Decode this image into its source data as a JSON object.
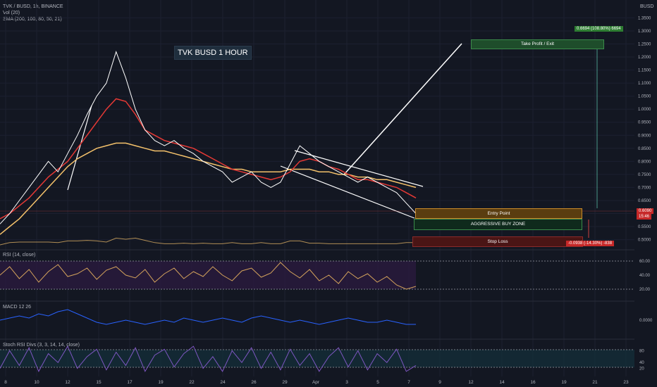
{
  "header": {
    "symbol": "TVK / BUSD, 1h, BINANCE",
    "vol": "Vol (20)",
    "sma": "SMA (200, 100, 80, 50, 21)",
    "currency": "BUSD"
  },
  "annotation_title": "TVK BUSD 1 HOUR",
  "zones": {
    "take_profit": "Take Profit / Exit",
    "entry": "Entry Point",
    "buy_zone": "AGGRESSIVE BUY ZONE",
    "stop_loss": "Stop Loss"
  },
  "labels": {
    "target": "0.6694 (108.80%) 6694",
    "stop": "-0.0938 (-14.30%) -838",
    "price_now": "0.6090",
    "countdown": "15:46"
  },
  "panes": {
    "rsi": "RSI (14, close)",
    "macd": "MACD 12 26",
    "stoch": "Stoch RSI Divs (3, 3, 14, 14, close)"
  },
  "colors": {
    "background": "#131722",
    "price": "#ffffff",
    "sma_fast": "#e53935",
    "sma_slow": "#f5c26b",
    "take_profit": "#1e4d2b",
    "entry": "#5a3d10",
    "stop": "#4a1515"
  },
  "chart_data": {
    "type": "line",
    "x_ticks": [
      "8",
      "10",
      "12",
      "15",
      "17",
      "19",
      "22",
      "24",
      "26",
      "29",
      "Apr",
      "3",
      "5",
      "7",
      "9",
      "12",
      "14",
      "16",
      "19",
      "21",
      "23"
    ],
    "price_axis": [
      "1.3500",
      "1.3000",
      "1.2500",
      "1.2000",
      "1.1500",
      "1.1000",
      "1.0500",
      "1.0000",
      "0.9500",
      "0.9000",
      "0.8500",
      "0.8000",
      "0.7500",
      "0.7000",
      "0.6500",
      "0.6000",
      "0.5500",
      "0.5000"
    ],
    "ylim": [
      0.48,
      1.37
    ],
    "price_series": [
      0.56,
      0.6,
      0.65,
      0.7,
      0.75,
      0.8,
      0.76,
      0.83,
      0.9,
      0.98,
      1.05,
      1.1,
      1.22,
      1.12,
      1.0,
      0.92,
      0.88,
      0.86,
      0.88,
      0.85,
      0.83,
      0.8,
      0.78,
      0.76,
      0.72,
      0.74,
      0.76,
      0.72,
      0.7,
      0.72,
      0.79,
      0.86,
      0.83,
      0.8,
      0.78,
      0.76,
      0.74,
      0.72,
      0.74,
      0.72,
      0.7,
      0.68,
      0.64,
      0.6
    ],
    "sma_fast": [
      0.58,
      0.6,
      0.63,
      0.66,
      0.7,
      0.74,
      0.77,
      0.8,
      0.85,
      0.9,
      0.95,
      1.0,
      1.04,
      1.03,
      0.98,
      0.92,
      0.9,
      0.88,
      0.87,
      0.86,
      0.85,
      0.83,
      0.81,
      0.79,
      0.77,
      0.76,
      0.75,
      0.74,
      0.73,
      0.74,
      0.76,
      0.8,
      0.81,
      0.8,
      0.78,
      0.77,
      0.75,
      0.73,
      0.73,
      0.72,
      0.71,
      0.7,
      0.68,
      0.66
    ],
    "sma_slow": [
      0.52,
      0.55,
      0.58,
      0.62,
      0.66,
      0.7,
      0.74,
      0.78,
      0.81,
      0.83,
      0.85,
      0.86,
      0.87,
      0.87,
      0.86,
      0.85,
      0.84,
      0.84,
      0.83,
      0.82,
      0.81,
      0.8,
      0.79,
      0.78,
      0.77,
      0.77,
      0.76,
      0.76,
      0.76,
      0.76,
      0.77,
      0.77,
      0.77,
      0.76,
      0.76,
      0.75,
      0.75,
      0.74,
      0.74,
      0.73,
      0.73,
      0.72,
      0.71,
      0.7
    ],
    "rsi_axis": [
      "60.00",
      "40.00",
      "20.00"
    ],
    "rsi_series": [
      50,
      62,
      45,
      58,
      40,
      55,
      65,
      48,
      52,
      60,
      44,
      57,
      62,
      50,
      46,
      58,
      40,
      52,
      60,
      45,
      55,
      48,
      62,
      50,
      42,
      56,
      60,
      47,
      53,
      68,
      55,
      46,
      58,
      42,
      50,
      38,
      55,
      45,
      52,
      40,
      48,
      36,
      30,
      34
    ],
    "macd_axis": [
      "0.0000"
    ],
    "macd_series": [
      0,
      0.01,
      0.02,
      0.01,
      0.03,
      0.02,
      0.04,
      0.05,
      0.03,
      0.01,
      -0.01,
      -0.02,
      -0.01,
      0.0,
      -0.01,
      -0.02,
      -0.01,
      0.0,
      -0.01,
      0.01,
      0.0,
      -0.01,
      0.0,
      0.01,
      0.0,
      -0.01,
      0.01,
      0.02,
      0.01,
      0.0,
      -0.01,
      0.0,
      -0.01,
      -0.02,
      -0.01,
      0.0,
      0.01,
      0.0,
      -0.01,
      -0.01,
      0.0,
      -0.01,
      -0.02,
      -0.02
    ],
    "stoch_axis": [
      "80",
      "40",
      "20"
    ],
    "stoch_series": [
      20,
      80,
      30,
      90,
      10,
      70,
      40,
      95,
      20,
      60,
      85,
      15,
      75,
      30,
      90,
      10,
      65,
      85,
      25,
      70,
      95,
      20,
      60,
      10,
      80,
      40,
      90,
      20,
      75,
      15,
      85,
      30,
      70,
      10,
      60,
      90,
      25,
      80,
      15,
      70,
      40,
      85,
      10,
      30
    ]
  }
}
